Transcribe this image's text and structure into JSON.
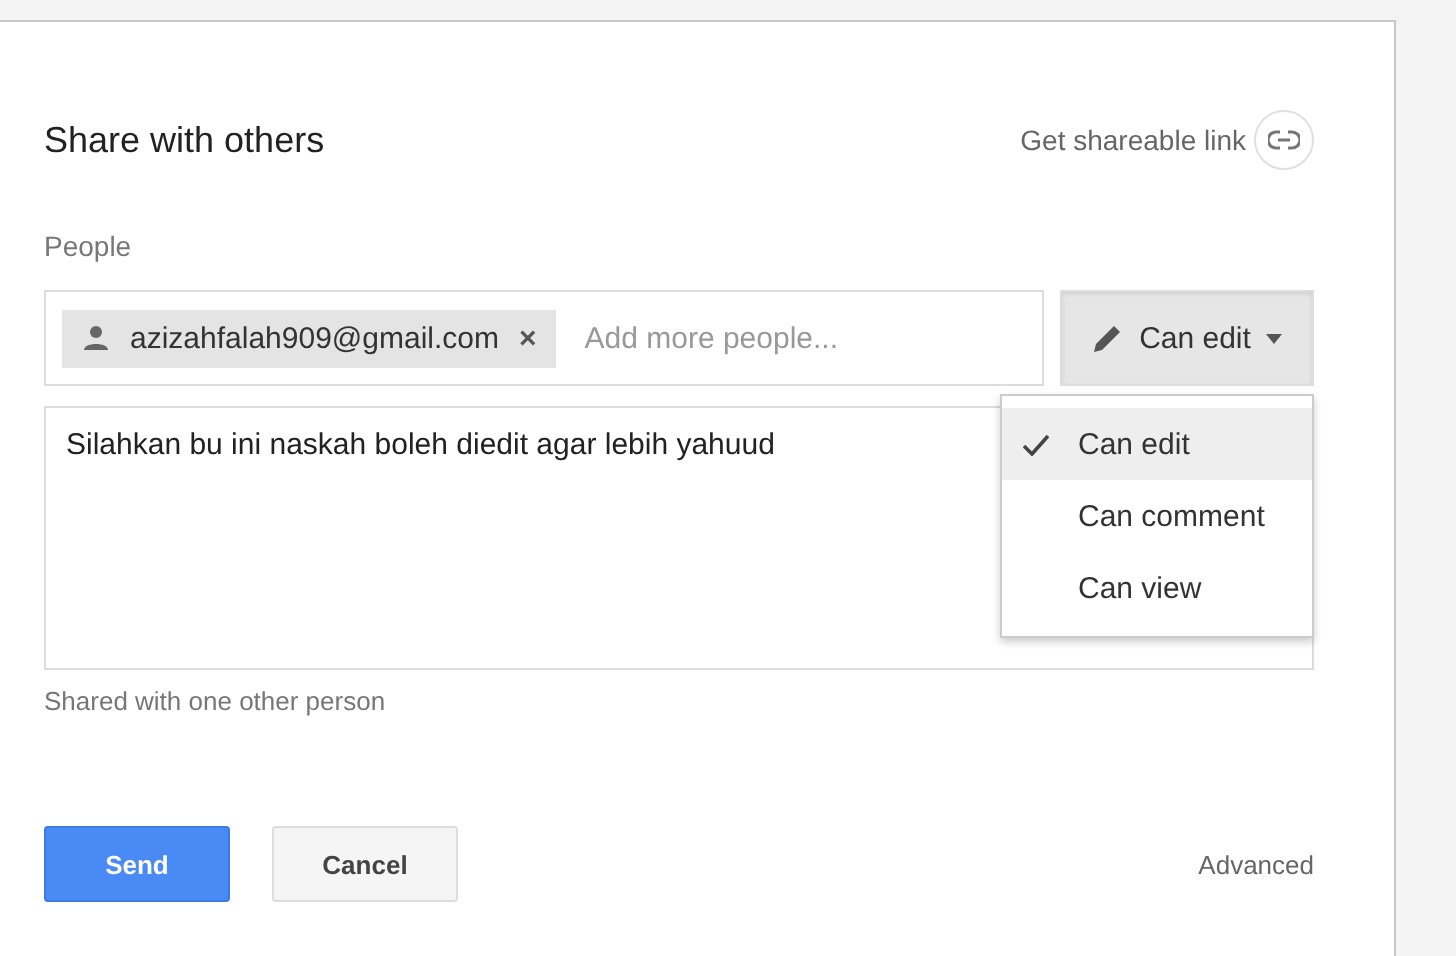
{
  "dialog": {
    "title": "Share with others",
    "shareable_link": "Get shareable link"
  },
  "people": {
    "label": "People",
    "chips": [
      {
        "email": "azizahfalah909@gmail.com",
        "remove": "×"
      }
    ],
    "placeholder": "Add more people...",
    "permission": {
      "label": "Can edit",
      "expanded": true
    },
    "options": [
      {
        "label": "Can edit",
        "selected": true
      },
      {
        "label": "Can comment",
        "selected": false
      },
      {
        "label": "Can view",
        "selected": false
      }
    ]
  },
  "message": {
    "value": "Silahkan bu ini naskah boleh diedit agar lebih yahuud"
  },
  "shared_note": "Shared with one other person",
  "buttons": [
    {
      "label": "Send",
      "kind": "primary"
    },
    {
      "label": "Cancel",
      "kind": "secondary"
    }
  ],
  "advanced": "Advanced"
}
